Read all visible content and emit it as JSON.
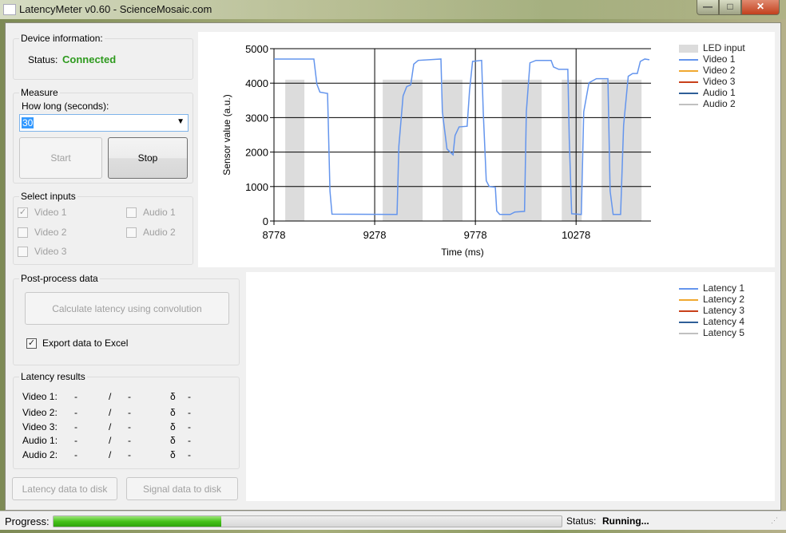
{
  "window": {
    "title": "LatencyMeter v0.60 - ScienceMosaic.com",
    "minimize": "—",
    "maximize": "□",
    "close": "✕"
  },
  "device": {
    "label": "Device information:",
    "status_label": "Status:",
    "status_value": "Connected",
    "status_color": "#2e9a1e"
  },
  "measure": {
    "label": "Measure",
    "duration_label": "How long (seconds):",
    "duration_value": "30",
    "start_label": "Start",
    "stop_label": "Stop"
  },
  "inputs": {
    "label": "Select inputs",
    "items": [
      {
        "label": "Video 1",
        "checked": true
      },
      {
        "label": "Video 2",
        "checked": false
      },
      {
        "label": "Video 3",
        "checked": false
      },
      {
        "label": "Audio 1",
        "checked": false
      },
      {
        "label": "Audio 2",
        "checked": false
      }
    ]
  },
  "postprocess": {
    "label": "Post-process data",
    "calc_label": "Calculate latency using convolution",
    "export_label": "Export data to Excel",
    "export_checked": true,
    "check_mark": "✓"
  },
  "results": {
    "label": "Latency results",
    "slash": "/",
    "delta": "δ",
    "rows": [
      {
        "name": "Video 1:",
        "a": "-",
        "b": "-",
        "d": "-"
      },
      {
        "name": "Video 2:",
        "a": "-",
        "b": "-",
        "d": "-"
      },
      {
        "name": "Video 3:",
        "a": "-",
        "b": "-",
        "d": "-"
      },
      {
        "name": "Audio 1:",
        "a": "-",
        "b": "-",
        "d": "-"
      },
      {
        "name": "Audio 2:",
        "a": "-",
        "b": "-",
        "d": "-"
      }
    ]
  },
  "disk": {
    "latency_label": "Latency data to disk",
    "signal_label": "Signal data to disk"
  },
  "statusbar": {
    "progress_label": "Progress:",
    "progress": 0.33,
    "status_label": "Status:",
    "status_value": "Running..."
  },
  "chart_data": {
    "type": "line",
    "xlabel": "Time (ms)",
    "ylabel": "Sensor value (a.u.)",
    "xlim": [
      8778,
      10650
    ],
    "ylim": [
      0,
      5000
    ],
    "xticks": [
      "8778",
      "9278",
      "9778",
      "10278"
    ],
    "yticks": [
      "0",
      "1000",
      "2000",
      "3000",
      "4000",
      "5000"
    ],
    "grid": true,
    "legend": "right",
    "led": {
      "name": "LED input",
      "color": "#dcdcdc",
      "value": 4100,
      "intervals": [
        [
          8834,
          8929
        ],
        [
          9318,
          9516
        ],
        [
          9615,
          9714
        ],
        [
          9909,
          10107
        ],
        [
          10207,
          10306
        ],
        [
          10405,
          10603
        ]
      ]
    },
    "series": [
      {
        "name": "Video 1",
        "color": "#6495ed",
        "points": [
          [
            8778,
            4700
          ],
          [
            8976,
            4700
          ],
          [
            8991,
            3970
          ],
          [
            9006,
            3740
          ],
          [
            9044,
            3700
          ],
          [
            9056,
            870
          ],
          [
            9066,
            200
          ],
          [
            9389,
            190
          ],
          [
            9398,
            2170
          ],
          [
            9419,
            3630
          ],
          [
            9437,
            3900
          ],
          [
            9457,
            3950
          ],
          [
            9472,
            4550
          ],
          [
            9494,
            4660
          ],
          [
            9607,
            4700
          ],
          [
            9614,
            3170
          ],
          [
            9637,
            2090
          ],
          [
            9667,
            1920
          ],
          [
            9677,
            2480
          ],
          [
            9697,
            2730
          ],
          [
            9737,
            2750
          ],
          [
            9749,
            3780
          ],
          [
            9764,
            4630
          ],
          [
            9809,
            4660
          ],
          [
            9817,
            3170
          ],
          [
            9832,
            1170
          ],
          [
            9847,
            1000
          ],
          [
            9877,
            980
          ],
          [
            9884,
            290
          ],
          [
            9899,
            190
          ],
          [
            9951,
            190
          ],
          [
            9974,
            260
          ],
          [
            10022,
            280
          ],
          [
            10031,
            3170
          ],
          [
            10049,
            4590
          ],
          [
            10079,
            4660
          ],
          [
            10154,
            4660
          ],
          [
            10166,
            4470
          ],
          [
            10192,
            4400
          ],
          [
            10237,
            4400
          ],
          [
            10244,
            2400
          ],
          [
            10256,
            210
          ],
          [
            10304,
            190
          ],
          [
            10316,
            3170
          ],
          [
            10342,
            4010
          ],
          [
            10379,
            4130
          ],
          [
            10436,
            4130
          ],
          [
            10447,
            870
          ],
          [
            10462,
            190
          ],
          [
            10499,
            190
          ],
          [
            10514,
            2780
          ],
          [
            10537,
            4200
          ],
          [
            10559,
            4280
          ],
          [
            10582,
            4280
          ],
          [
            10597,
            4630
          ],
          [
            10619,
            4700
          ],
          [
            10642,
            4680
          ]
        ]
      },
      {
        "name": "Video 2",
        "color": "#f0a830",
        "points": []
      },
      {
        "name": "Video 3",
        "color": "#c8401a",
        "points": []
      },
      {
        "name": "Audio 1",
        "color": "#2f5f98",
        "points": []
      },
      {
        "name": "Audio 2",
        "color": "#c0c0c0",
        "points": []
      }
    ]
  },
  "latency_legend": [
    {
      "name": "Latency 1",
      "color": "#6495ed"
    },
    {
      "name": "Latency 2",
      "color": "#f0a830"
    },
    {
      "name": "Latency 3",
      "color": "#c8401a"
    },
    {
      "name": "Latency 4",
      "color": "#2f5f98"
    },
    {
      "name": "Latency 5",
      "color": "#c0c0c0"
    }
  ]
}
